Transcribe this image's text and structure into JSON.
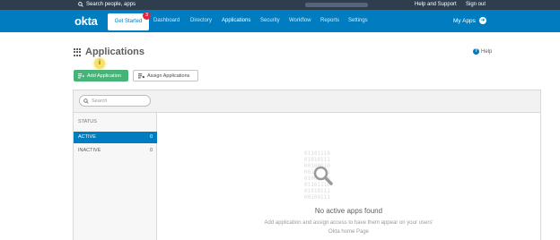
{
  "topbar": {
    "search_label": "Search people, apps",
    "help_label": "Help and Support",
    "signout_label": "Sign out"
  },
  "nav": {
    "logo": "okta",
    "get_started": "Get Started",
    "badge_count": "3",
    "items": [
      "Dashboard",
      "Directory",
      "Applications",
      "Security",
      "Workflow",
      "Reports",
      "Settings"
    ],
    "active_item": "Applications",
    "my_apps": "My Apps"
  },
  "page": {
    "title": "Applications",
    "help": "Help",
    "hint_marker": "i",
    "add_button": "Add Application",
    "assign_button": "Assign Applications"
  },
  "panel": {
    "search_placeholder": "Search",
    "status_header": "STATUS",
    "statuses": [
      {
        "label": "ACTIVE",
        "count": "0",
        "selected": true
      },
      {
        "label": "INACTIVE",
        "count": "0",
        "selected": false
      }
    ],
    "empty_title": "No active apps found",
    "empty_line1": "Add application and assign access to have them appear on your users'",
    "empty_line2": "Okta home Page",
    "bits": [
      "01101110",
      "01010111",
      "00100010",
      "00110101",
      "01001100",
      "01101110",
      "01010111",
      "00100111"
    ]
  },
  "colors": {
    "brand_blue": "#007dc1",
    "top_strip": "#2f3e4f",
    "success_green": "#46b478",
    "badge_red": "#e4253f"
  }
}
